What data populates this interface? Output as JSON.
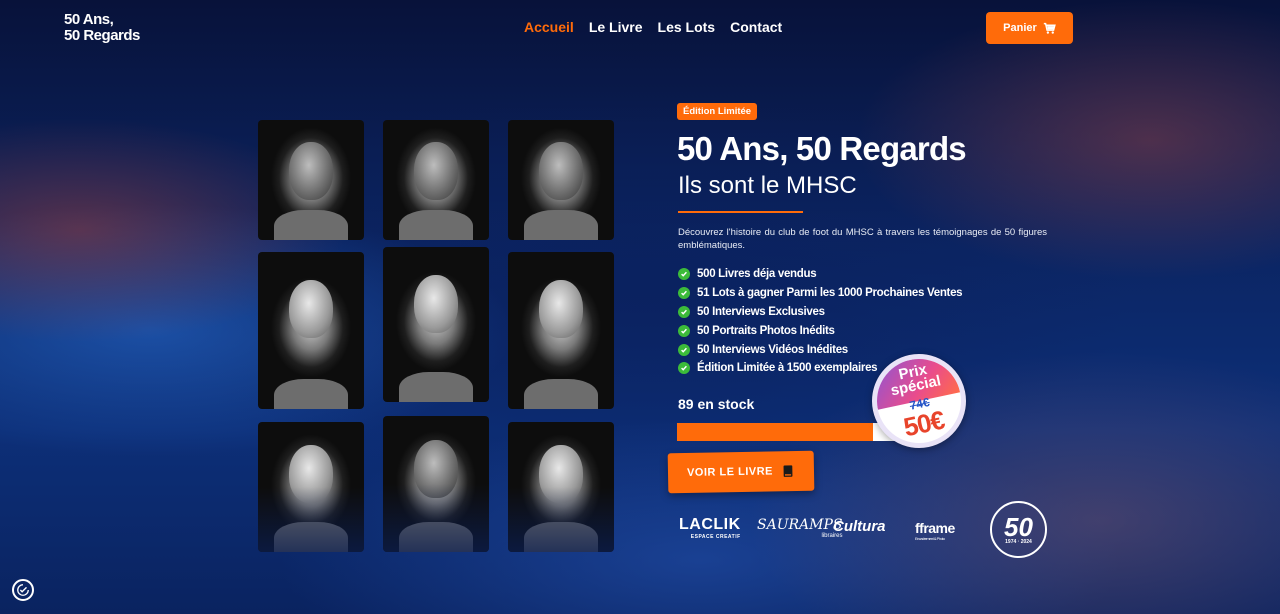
{
  "header": {
    "logo_line1": "50 Ans,",
    "logo_line2": "50 Regards",
    "nav": [
      {
        "label": "Accueil",
        "active": true
      },
      {
        "label": "Le Livre",
        "active": false
      },
      {
        "label": "Les Lots",
        "active": false
      },
      {
        "label": "Contact",
        "active": false
      }
    ],
    "cart_label": "Panier",
    "cart_icon": "shopping-cart-icon"
  },
  "hero": {
    "badge": "Édition Limitée",
    "title": "50 Ans, 50 Regards",
    "subtitle": "Ils sont le MHSC",
    "description": "Découvrez l'histoire du club de foot du MHSC à travers les témoignages de 50 figures emblématiques.",
    "features": [
      "500 Livres déja vendus",
      "51 Lots à gagner Parmi les 1000 Prochaines Ventes",
      "50 Interviews Exclusives",
      "50 Portraits Photos Inédits",
      "50 Interviews Vidéos Inédites",
      "Édition Limitée à 1500 exemplaires"
    ],
    "stock_text": "89 en stock",
    "stock_progress_percent": 85,
    "cta_label": "VOIR LE LIVRE",
    "cta_icon": "book-icon"
  },
  "price_seal": {
    "label_line1": "Prix",
    "label_line2": "spécial",
    "old_price": "74€",
    "new_price": "50€"
  },
  "portraits_count": 9,
  "partners": {
    "laclik": "LACLIK",
    "laclik_sub": "ESPACE CREATIF",
    "sauramps": "SAURAMPS",
    "sauramps_sub": "libraires",
    "cultura": "Cultura",
    "fframe": "fframe",
    "fframe_sub": "Encadrement & Photo",
    "mhsc_number": "50",
    "mhsc_years": "1974 · 2024"
  },
  "colors": {
    "accent": "#ff6b0a",
    "check_green": "#3cbb3a",
    "background_dark": "#0b2563"
  }
}
